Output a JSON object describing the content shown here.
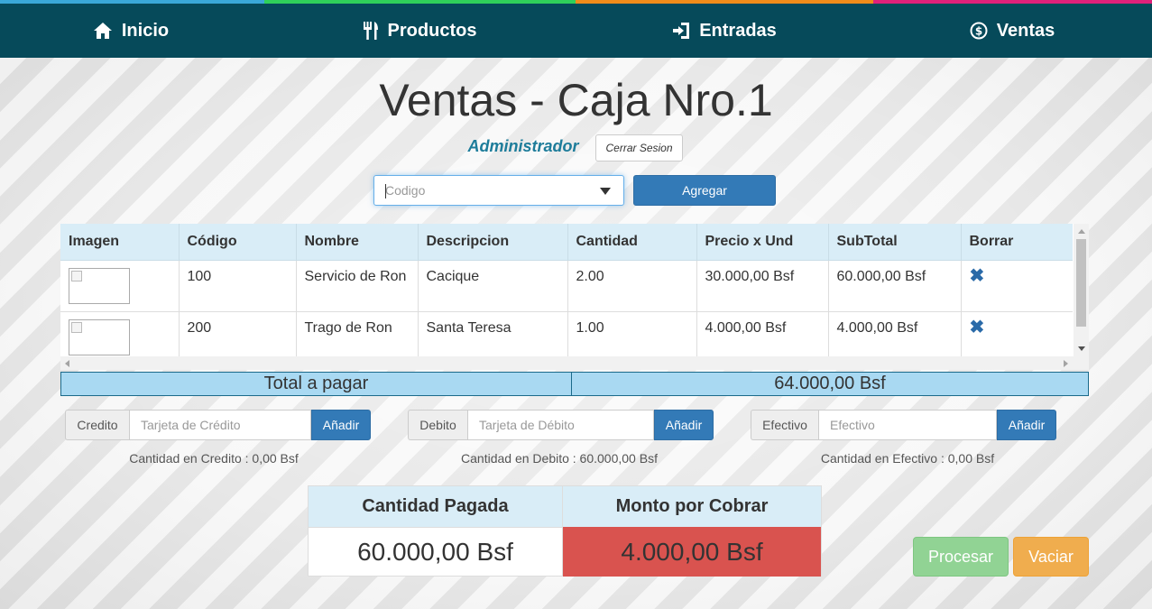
{
  "nav": {
    "items": [
      {
        "label": "Inicio",
        "icon": "home-icon"
      },
      {
        "label": "Productos",
        "icon": "cutlery-icon"
      },
      {
        "label": "Entradas",
        "icon": "log-in-icon"
      },
      {
        "label": "Ventas",
        "icon": "usd-circle-icon"
      }
    ],
    "colors": {
      "bar": "#064a5a",
      "stripes": [
        "#3aa8d8",
        "#2fd05a",
        "#f08c1a",
        "#e0217a"
      ]
    }
  },
  "header": {
    "title": "Ventas - Caja Nro.1",
    "user": "Administrador",
    "logout_label": "Cerrar Sesion"
  },
  "search": {
    "placeholder": "Codigo",
    "add_label": "Agregar"
  },
  "table": {
    "columns": [
      "Imagen",
      "Código",
      "Nombre",
      "Descripcion",
      "Cantidad",
      "Precio x Und",
      "SubTotal",
      "Borrar"
    ],
    "rows": [
      {
        "codigo": "100",
        "nombre": "Servicio de Ron",
        "descripcion": "Cacique",
        "cantidad": "2.00",
        "precio": "30.000,00 Bsf",
        "subtotal": "60.000,00 Bsf"
      },
      {
        "codigo": "200",
        "nombre": "Trago de Ron",
        "descripcion": "Santa Teresa",
        "cantidad": "1.00",
        "precio": "4.000,00 Bsf",
        "subtotal": "4.000,00 Bsf"
      }
    ]
  },
  "total": {
    "label": "Total a pagar",
    "value": "64.000,00 Bsf"
  },
  "payments": [
    {
      "addon": "Credito",
      "placeholder": "Tarjeta de Crédito",
      "button": "Añadir",
      "note": "Cantidad en Credito : 0,00 Bsf"
    },
    {
      "addon": "Debito",
      "placeholder": "Tarjeta de Débito",
      "button": "Añadir",
      "note": "Cantidad en Debito : 60.000,00 Bsf"
    },
    {
      "addon": "Efectivo",
      "placeholder": "Efectivo",
      "button": "Añadir",
      "note": "Cantidad en Efectivo : 0,00 Bsf"
    }
  ],
  "summary": {
    "paid_label": "Cantidad Pagada",
    "paid_value": "60.000,00 Bsf",
    "due_label": "Monto por Cobrar",
    "due_value": "4.000,00 Bsf",
    "due_color": "#d9534f"
  },
  "actions": {
    "process_label": "Procesar",
    "clear_label": "Vaciar"
  }
}
